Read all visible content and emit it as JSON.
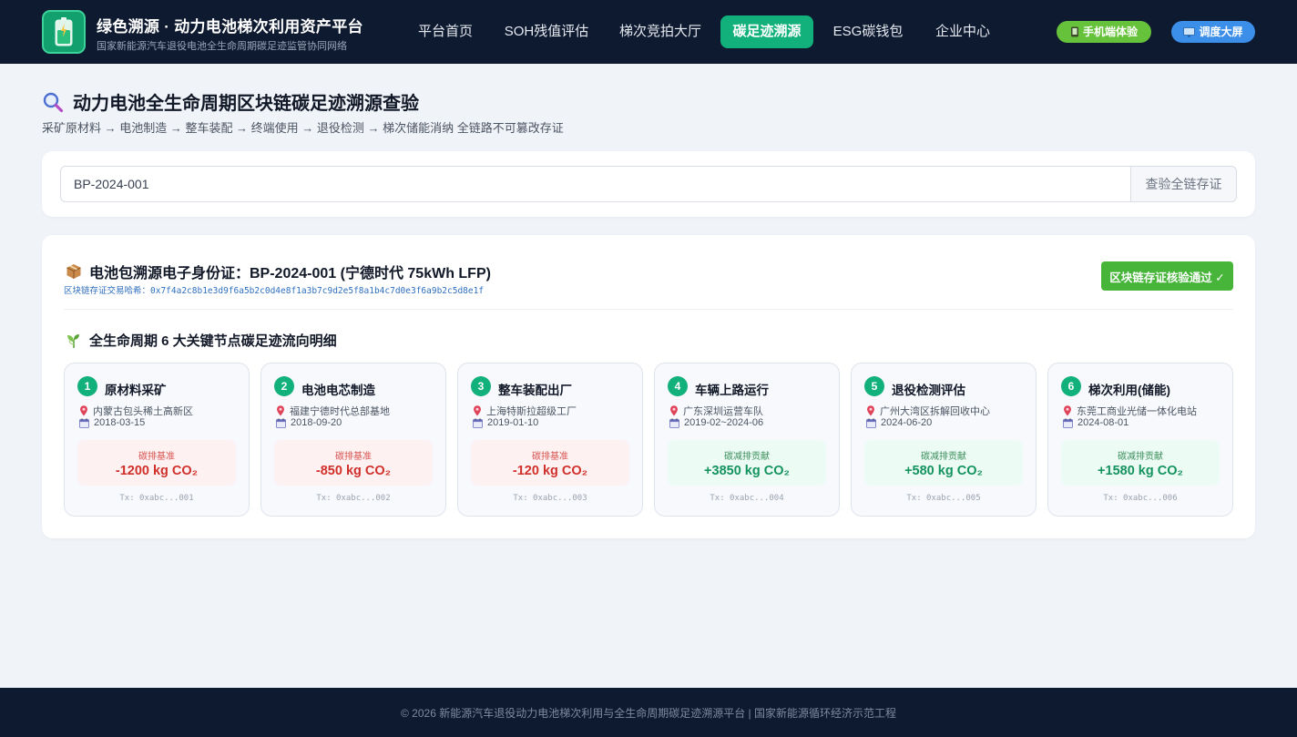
{
  "header": {
    "title": "绿色溯源 · 动力电池梯次利用资产平台",
    "subtitle": "国家新能源汽车退役电池全生命周期碳足迹监管协同网络",
    "logo_icon": "battery-icon",
    "nav": [
      {
        "label": "平台首页",
        "active": false
      },
      {
        "label": "SOH残值评估",
        "active": false
      },
      {
        "label": "梯次竞拍大厅",
        "active": false
      },
      {
        "label": "碳足迹溯源",
        "active": true
      },
      {
        "label": "ESG碳钱包",
        "active": false
      },
      {
        "label": "企业中心",
        "active": false
      }
    ],
    "mobile_button": {
      "icon": "phone-icon",
      "label": "手机端体验",
      "color": "#66c23a"
    },
    "screen_button": {
      "icon": "monitor-icon",
      "label": "调度大屏",
      "color": "#3b8fe8"
    }
  },
  "page": {
    "title_icon": "magnifier-icon",
    "title": "动力电池全生命周期区块链碳足迹溯源查验",
    "subtitle": "采矿原材料 → 电池制造 → 整车装配 → 终端使用 → 退役检测 → 梯次储能消纳 全链路不可篡改存证"
  },
  "search": {
    "value": "BP-2024-001",
    "button_label": "查验全链存证"
  },
  "result": {
    "icon": "package-icon",
    "title": "电池包溯源电子身份证：BP-2024-001 (宁德时代 75kWh LFP)",
    "hash_label": "区块链存证交易哈希：",
    "hash": "0x7f4a2c8b1e3d9f6a5b2c0d4e8f1a3b7c9d2e5f8a1b4c7d0e3f6a9b2c5d8e1f",
    "verify_badge": "区块链存证核验通过 ✓",
    "section_icon": "seedling-icon",
    "section_title": "全生命周期 6 大关键节点碳足迹流向明细"
  },
  "nodes": [
    {
      "num": "1",
      "title": "原材料采矿",
      "location": "内蒙古包头稀土高新区",
      "date": "2018-03-15",
      "type": "neg",
      "label": "碳排基准",
      "value": "-1200 kg CO₂",
      "tx": "Tx: 0xabc...001"
    },
    {
      "num": "2",
      "title": "电池电芯制造",
      "location": "福建宁德时代总部基地",
      "date": "2018-09-20",
      "type": "neg",
      "label": "碳排基准",
      "value": "-850 kg CO₂",
      "tx": "Tx: 0xabc...002"
    },
    {
      "num": "3",
      "title": "整车装配出厂",
      "location": "上海特斯拉超级工厂",
      "date": "2019-01-10",
      "type": "neg",
      "label": "碳排基准",
      "value": "-120 kg CO₂",
      "tx": "Tx: 0xabc...003"
    },
    {
      "num": "4",
      "title": "车辆上路运行",
      "location": "广东深圳运营车队",
      "date": "2019-02~2024-06",
      "type": "pos",
      "label": "碳减排贡献",
      "value": "+3850 kg CO₂",
      "tx": "Tx: 0xabc...004"
    },
    {
      "num": "5",
      "title": "退役检测评估",
      "location": "广州大湾区拆解回收中心",
      "date": "2024-06-20",
      "type": "pos",
      "label": "碳减排贡献",
      "value": "+580 kg CO₂",
      "tx": "Tx: 0xabc...005"
    },
    {
      "num": "6",
      "title": "梯次利用(储能)",
      "location": "东莞工商业光储一体化电站",
      "date": "2024-08-01",
      "type": "pos",
      "label": "碳减排贡献",
      "value": "+1580 kg CO₂",
      "tx": "Tx: 0xabc...006"
    }
  ],
  "footer": {
    "text": "© 2026 新能源汽车退役动力电池梯次利用与全生命周期碳足迹溯源平台 | 国家新能源循环经济示范工程"
  }
}
